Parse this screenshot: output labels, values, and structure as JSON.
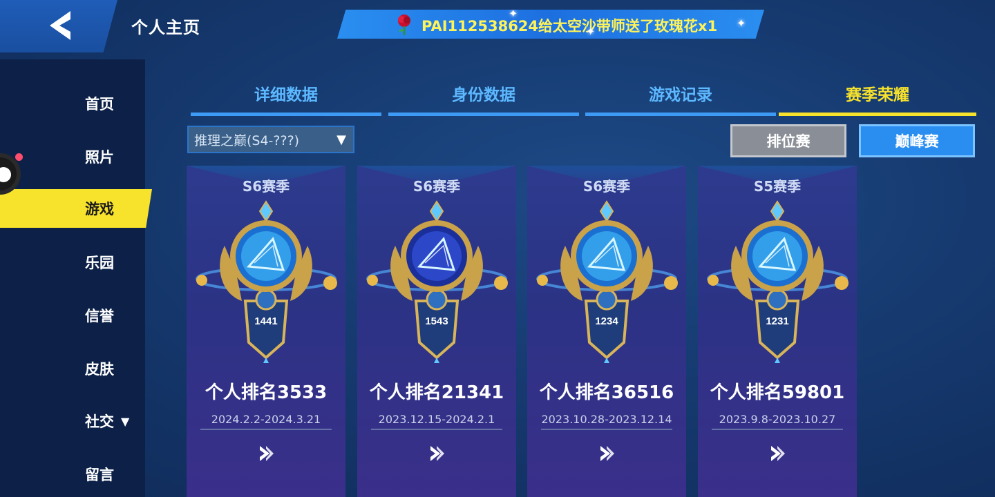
{
  "header": {
    "title": "个人主页",
    "gift_message": "PAI112538624给太空沙带师送了玫瑰花x1"
  },
  "sidebar": {
    "items": [
      {
        "label": "首页"
      },
      {
        "label": "照片"
      },
      {
        "label": "游戏",
        "active": true
      },
      {
        "label": "乐园"
      },
      {
        "label": "信誉"
      },
      {
        "label": "皮肤"
      },
      {
        "label": "社交",
        "arrow": "▼"
      },
      {
        "label": "留言"
      }
    ]
  },
  "tabs": [
    {
      "label": "详细数据"
    },
    {
      "label": "身份数据"
    },
    {
      "label": "游戏记录"
    },
    {
      "label": "赛季荣耀",
      "active": true
    }
  ],
  "filters": {
    "season_select": "推理之巅(S4-???)",
    "ranked_button": "排位赛",
    "peak_button": "巅峰赛"
  },
  "cards": [
    {
      "season": "S6赛季",
      "score": "1441",
      "rank": "个人排名3533",
      "dates": "2024.2.2-2024.3.21"
    },
    {
      "season": "S6赛季",
      "score": "1543",
      "rank": "个人排名21341",
      "dates": "2023.12.15-2024.2.1"
    },
    {
      "season": "S6赛季",
      "score": "1234",
      "rank": "个人排名36516",
      "dates": "2023.10.28-2023.12.14"
    },
    {
      "season": "S5赛季",
      "score": "1231",
      "rank": "个人排名59801",
      "dates": "2023.9.8-2023.10.27"
    }
  ],
  "colors": {
    "accent_yellow": "#f7e22c",
    "tab_blue": "#3e9bf5",
    "card_purple": "#2d3b8e"
  }
}
